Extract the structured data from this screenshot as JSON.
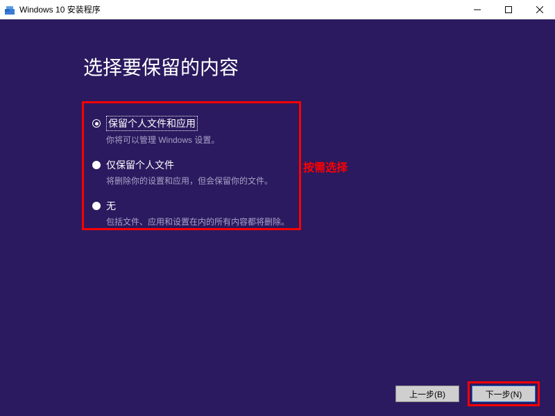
{
  "window": {
    "title": "Windows 10 安装程序"
  },
  "heading": "选择要保留的内容",
  "options": [
    {
      "label": "保留个人文件和应用",
      "desc": "你将可以管理 Windows 设置。",
      "selected": true
    },
    {
      "label": "仅保留个人文件",
      "desc": "将删除你的设置和应用，但会保留你的文件。",
      "selected": false
    },
    {
      "label": "无",
      "desc": "包括文件、应用和设置在内的所有内容都将删除。",
      "selected": false
    }
  ],
  "annotation": "按需选择",
  "buttons": {
    "back": "上一步(B)",
    "next": "下一步(N)"
  },
  "colors": {
    "background": "#2b1a5f",
    "highlight": "#ff0000"
  }
}
